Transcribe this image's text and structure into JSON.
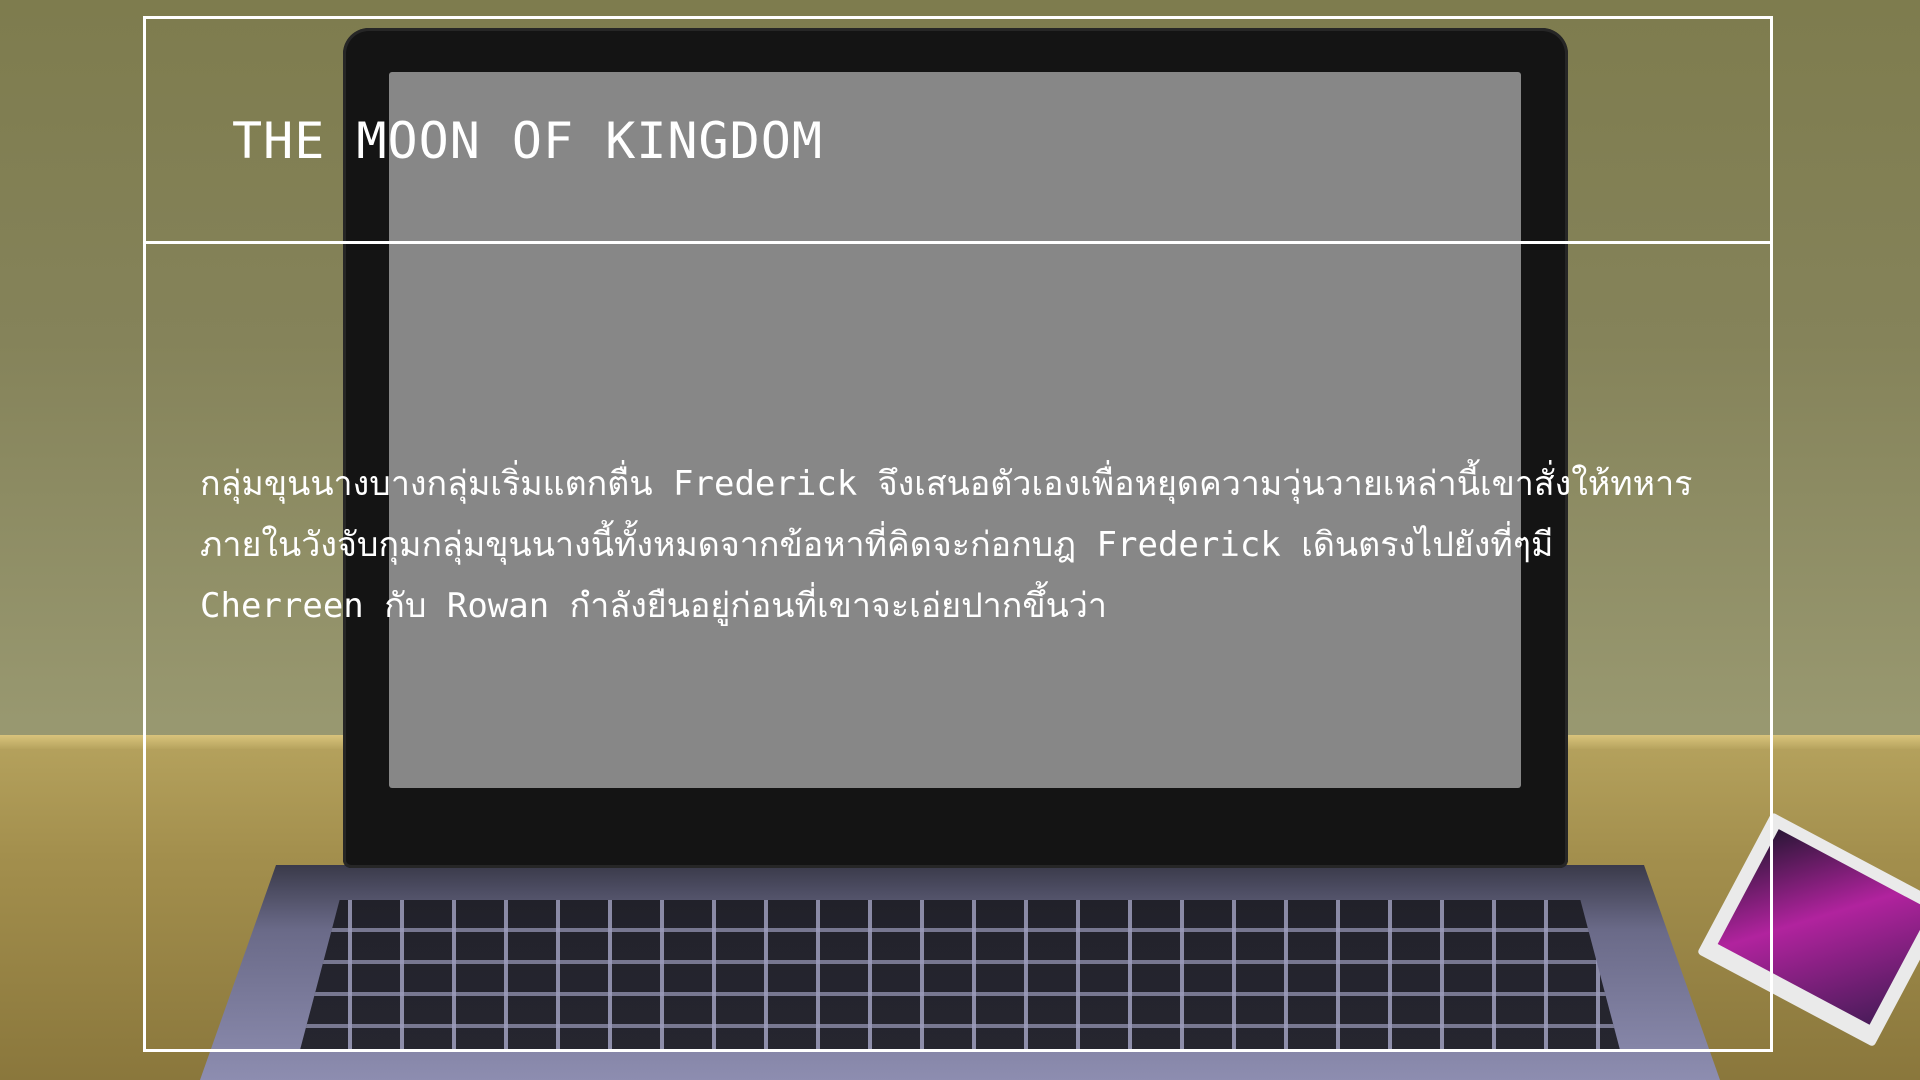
{
  "slide": {
    "title": "THE MOON OF KINGDOM",
    "body_lines": [
      "กลุ่มขุนนางบางกลุ่มเริ่มแตกตื่น Frederick จึงเสนอตัวเองเพื่อหยุดความวุ่นวายเหล่านี้เขาสั่งให้ทหาร",
      "ภายในวังจับกุมกลุ่มขุนนางนี้ทั้งหมดจากข้อหาที่คิดจะก่อกบฎ Frederick เดินตรงไปยังที่ๆมี",
      "Cherreen กับ Rowan กำลังยืนอยู่ก่อนที่เขาจะเอ่ยปากขึ้นว่า"
    ]
  },
  "colors": {
    "text": "#ffffff",
    "frame_border": "#ffffff",
    "screen": "#878787"
  }
}
